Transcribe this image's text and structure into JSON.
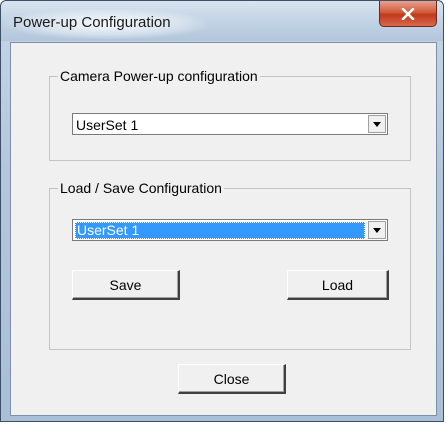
{
  "window": {
    "title": "Power-up Configuration",
    "close_label": "x"
  },
  "camera_group": {
    "legend": "Camera Power-up configuration",
    "select_value": "UserSet 1"
  },
  "load_save_group": {
    "legend": "Load / Save Configuration",
    "select_value": "UserSet 1",
    "save_label": "Save",
    "load_label": "Load"
  },
  "footer": {
    "close_label": "Close"
  }
}
